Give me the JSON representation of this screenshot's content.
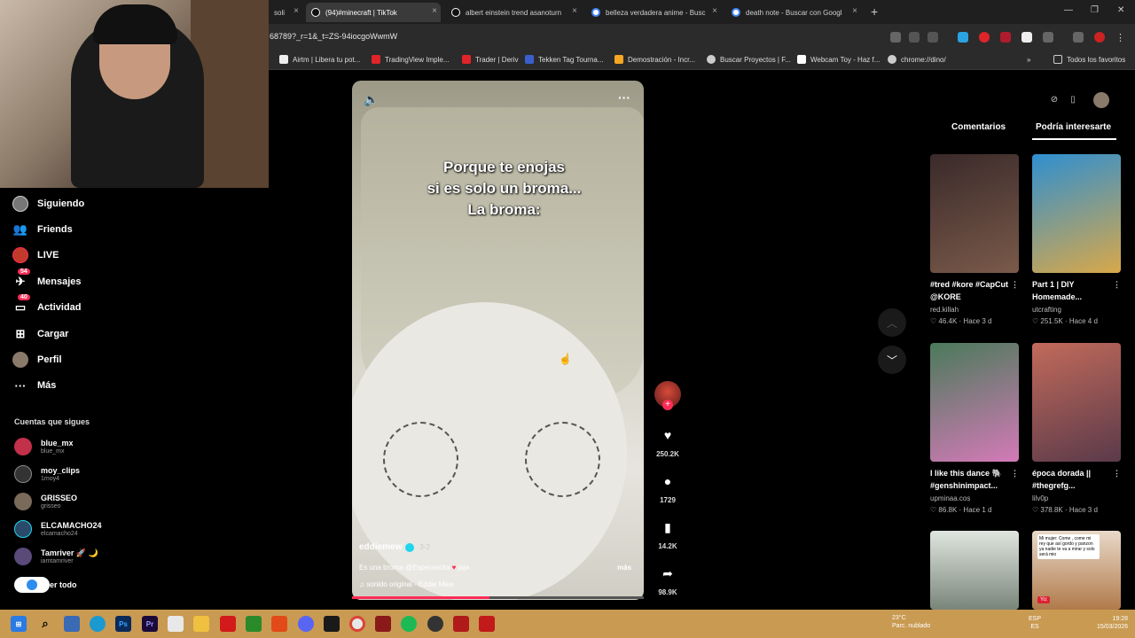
{
  "browser": {
    "tabs": [
      {
        "label": "(94)#minecraft | TikTok",
        "active": true
      },
      {
        "label": "albert einstein trend asanoturn"
      },
      {
        "label": "belleza verdadera anime - Busc"
      },
      {
        "label": "death note - Buscar con Googl"
      }
    ],
    "tab_partial": "soli",
    "new_tab": "+",
    "url": "68789?_r=1&_t=ZS-94iocgoWwmW",
    "bookmarks": [
      "Airtm | Libera tu pot...",
      "TradingView Imple...",
      "Trader | Deriv",
      "Tekken Tag Tourna...",
      "Demostración - Incr...",
      "Buscar Proyectos | F...",
      "Webcam Toy - Haz f...",
      "chrome://dino/"
    ],
    "bookmarks_overflow": "»",
    "all_bookmarks": "Todos los favoritos"
  },
  "sidebar": {
    "nav": [
      {
        "label": "Siguiendo",
        "icon": "following-avatar-icon"
      },
      {
        "label": "Friends",
        "icon": "friends-icon"
      },
      {
        "label": "LIVE",
        "icon": "live-icon"
      },
      {
        "label": "Mensajes",
        "icon": "messages-icon",
        "badge": "54"
      },
      {
        "label": "Actividad",
        "icon": "activity-icon",
        "badge": "40"
      },
      {
        "label": "Cargar",
        "icon": "upload-icon"
      },
      {
        "label": "Perfil",
        "icon": "profile-icon"
      },
      {
        "label": "Más",
        "icon": "more-icon"
      }
    ],
    "following_title": "Cuentas que sigues",
    "accounts": [
      {
        "name": "blue_mx",
        "handle": "blue_mx"
      },
      {
        "name": "moy_clips",
        "handle": "1moy4"
      },
      {
        "name": "GRISSEO",
        "handle": "grisseo"
      },
      {
        "name": "ELCAMACHO24",
        "handle": "elcamacho24"
      },
      {
        "name": "Tamriver 🚀 🌙",
        "handle": "iamtamriver"
      }
    ],
    "see_all": "er todo"
  },
  "video": {
    "caption_lines": [
      "Porque te enojas",
      "si es solo un broma...",
      "La broma:"
    ],
    "author": "eddiemew",
    "date": "3-2",
    "description_pre": "Es una broma @Esperancita",
    "description_heart": "♥",
    "description_post": "jaja",
    "more": "más",
    "sound": "♫ sonido original - Eddie Mew",
    "progress": 0.47
  },
  "actions": {
    "likes": "250.2K",
    "comments": "1729",
    "saves": "14.2K",
    "shares": "98.9K"
  },
  "right_panel": {
    "tabs": [
      "Comentarios",
      "Podría interesarte"
    ],
    "active_tab": 1,
    "cards": [
      {
        "title": "#tred #kore #CapCut @KORE",
        "user": "red.killah",
        "views": "46.4K",
        "age": "Hace 3 d",
        "color": "#6b4c3b"
      },
      {
        "title": "Part 1 | DIY Homemade...",
        "user": "utcrafting",
        "views": "251.5K",
        "age": "Hace 4 d",
        "color": "#3a8fc9"
      },
      {
        "title": "I like this dance 🐘 #genshinimpact...",
        "user": "upminaa.cos",
        "views": "86.8K",
        "age": "Hace 1 d",
        "color": "#c27ab0"
      },
      {
        "title": "época dorada || #thegrefg...",
        "user": "lilv0p",
        "views": "378.8K",
        "age": "Hace 3 d",
        "color": "#b55a4a"
      },
      {
        "title": "",
        "user": "",
        "views": "",
        "age": "",
        "color": "#9aa59a"
      },
      {
        "title": "",
        "user": "",
        "views": "",
        "age": "",
        "color": "#c98a4a"
      }
    ],
    "card6_overlay": "Mi mujer: Come , come mi rey que así gordo y panzon ya nadie te va a mirar y solo será mio",
    "card6_tag": "Yo:"
  },
  "taskbar": {
    "weather_temp": "23°C",
    "weather_desc": "Parc. nublado",
    "lang1": "ESP",
    "lang2": "ES",
    "time": "19:28",
    "date": "15/03/2026"
  }
}
